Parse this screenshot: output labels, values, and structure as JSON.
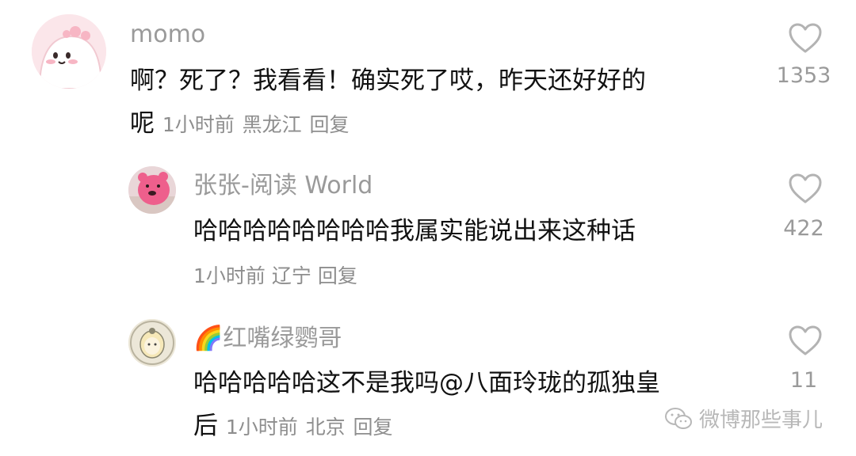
{
  "comments": [
    {
      "user": "momo",
      "text_line1": "啊？死了？我看看！确实死了哎，昨天还好好的",
      "text_line2": "呢",
      "time": "1小时前",
      "location": "黑龙江",
      "reply_label": "回复",
      "likes": "1353",
      "avatar_icon": "pink-dino-avatar-icon"
    },
    {
      "user": "张张-阅读 World",
      "text_line1": "哈哈哈哈哈哈哈哈我属实能说出来这种话",
      "time": "1小时前",
      "location": "辽宁",
      "reply_label": "回复",
      "likes": "422",
      "avatar_icon": "pink-plush-avatar-icon"
    },
    {
      "user_emoji": "🌈",
      "user": "红嘴绿鹦哥",
      "text_line1": "哈哈哈哈哈这不是我吗",
      "mention": "@八面玲珑的孤独皇",
      "text_line2": "后",
      "time": "1小时前",
      "location": "北京",
      "reply_label": "回复",
      "likes": "11",
      "avatar_icon": "cartoon-girl-avatar-icon"
    }
  ],
  "watermark": {
    "text": "微博那些事儿",
    "icon": "wechat-icon"
  },
  "colors": {
    "username": "#9a9a9a",
    "text": "#111111",
    "meta": "#8e8e8e"
  }
}
